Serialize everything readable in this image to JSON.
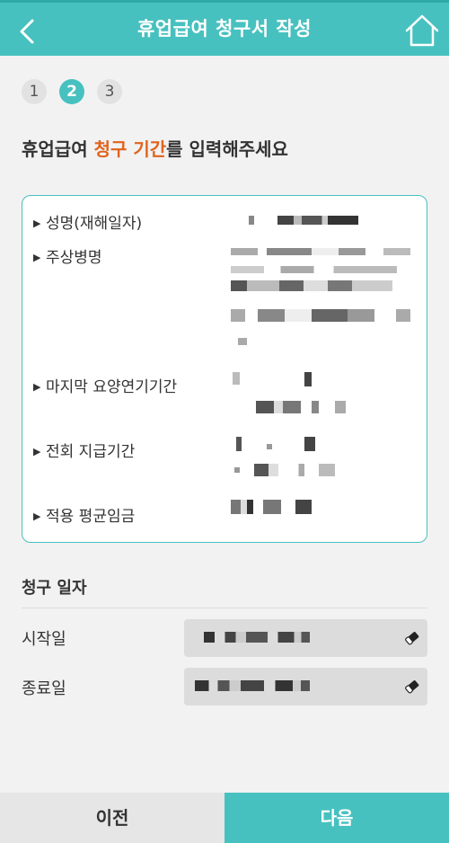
{
  "header": {
    "title": "휴업급여 청구서 작성",
    "back_icon": "back-chevron-icon",
    "home_icon": "home-icon"
  },
  "steps": [
    "1",
    "2",
    "3"
  ],
  "active_step": "2",
  "heading": {
    "prefix": "휴업급여 ",
    "highlight": "청구 기간",
    "suffix": "를 입력해주세요"
  },
  "info": {
    "name_label": "성명(재해일자)",
    "disease_label": "주상병명",
    "last_treatment_label": "마지막 요양연기기간",
    "prev_payment_label": "전회 지급기간",
    "avg_wage_label": "적용 평균임금"
  },
  "claim_date": {
    "section_title": "청구 일자",
    "start_label": "시작일",
    "end_label": "종료일",
    "eraser_icon": "eraser-icon"
  },
  "buttons": {
    "prev": "이전",
    "next": "다음"
  },
  "colors": {
    "accent": "#47c1bf",
    "highlight": "#e0631c"
  }
}
